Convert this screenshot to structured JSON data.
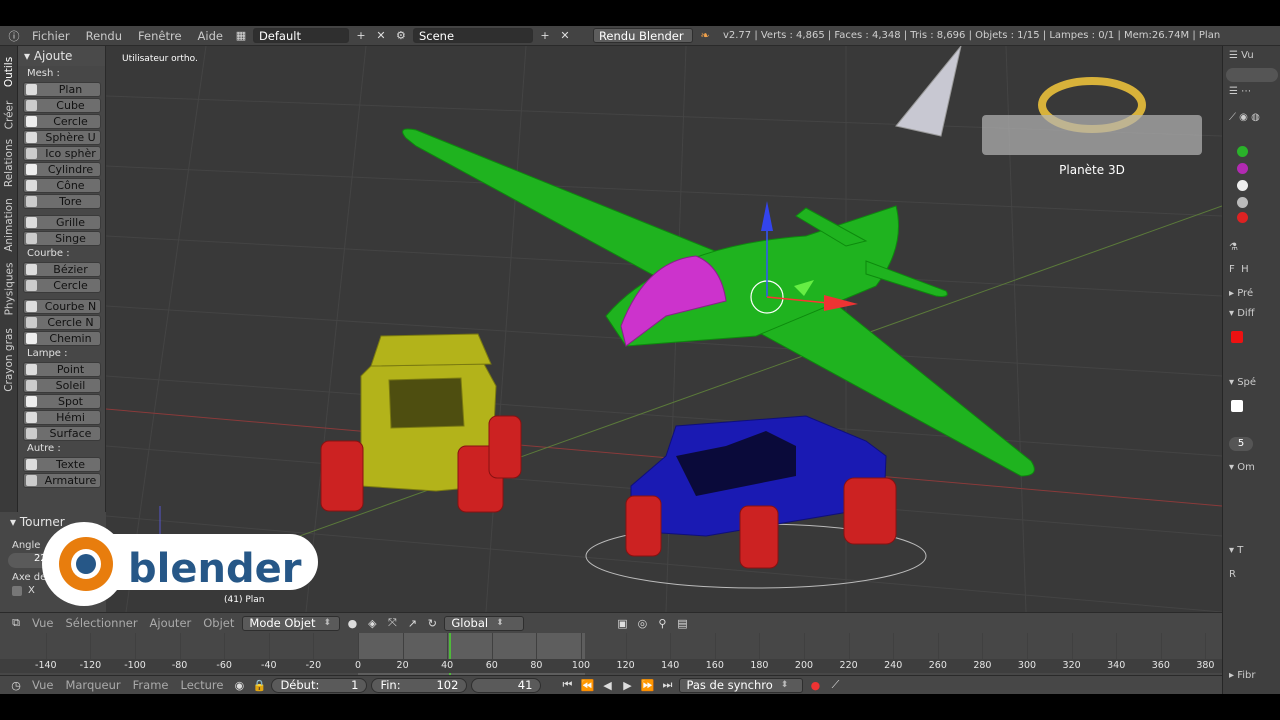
{
  "topbar": {
    "menus": [
      "Fichier",
      "Rendu",
      "Fenêtre",
      "Aide"
    ],
    "layout": "Default",
    "scene": "Scene",
    "engine": "Rendu Blender",
    "stats": "v2.77 | Verts : 4,865 | Faces : 4,348 | Tris : 8,696 | Objets : 1/15 | Lampes : 0/1 | Mem:26.74M | Plan"
  },
  "tabs": [
    "Outils",
    "Créer",
    "Relations",
    "Animation",
    "Physiques",
    "Crayon gras"
  ],
  "toolshelf": {
    "title": "Ajoute",
    "sections": [
      {
        "label": "Mesh :",
        "items": [
          "Plan",
          "Cube",
          "Cercle",
          "Sphère U",
          "Ico sphèr",
          "Cylindre",
          "Cône",
          "Tore"
        ]
      },
      {
        "label": "",
        "items": [
          "Grille",
          "Singe"
        ]
      },
      {
        "label": "Courbe :",
        "items": [
          "Bézier",
          "Cercle"
        ]
      },
      {
        "label": "",
        "items": [
          "Courbe N",
          "Cercle N",
          "Chemin"
        ]
      },
      {
        "label": "Lampe :",
        "items": [
          "Point",
          "Soleil",
          "Spot",
          "Hémi",
          "Surface"
        ]
      },
      {
        "label": "Autre :",
        "items": [
          "Texte",
          "Armature"
        ]
      }
    ]
  },
  "operator": {
    "title": "Tourner",
    "angle_label": "Angle",
    "angle_value": "22",
    "axis_label": "Axe de",
    "axis_x": "X"
  },
  "viewport": {
    "view_label": "Utilisateur ortho.",
    "object_label": "(41) Plan"
  },
  "view_header": {
    "menus": [
      "Vue",
      "Sélectionner",
      "Ajouter",
      "Objet"
    ],
    "mode": "Mode Objet",
    "orientation": "Global"
  },
  "timeline": {
    "ticks": [
      "-140",
      "-120",
      "-100",
      "-80",
      "-60",
      "-40",
      "-20",
      "0",
      "20",
      "40",
      "60",
      "80",
      "100",
      "120",
      "140",
      "160",
      "180",
      "200",
      "220",
      "240",
      "260",
      "280",
      "300",
      "320",
      "340",
      "360",
      "380"
    ],
    "range_start": 0,
    "range_end": 102,
    "current_frame": 41
  },
  "timeline_header": {
    "menus": [
      "Vue",
      "Marqueur",
      "Frame",
      "Lecture"
    ],
    "start_label": "Début:",
    "start_value": "1",
    "end_label": "Fin:",
    "end_value": "102",
    "current": "41",
    "sync": "Pas de synchro"
  },
  "properties": {
    "labels": [
      "Vu",
      "Pré",
      "Diff",
      "Spé",
      "Om",
      "T",
      "R",
      "Fibr"
    ],
    "value": "5",
    "f_label": "F",
    "h_label": "H"
  },
  "logo": {
    "text": "blender"
  },
  "brand": {
    "subtitle": "Planète 3D"
  },
  "colors": {
    "plane": "#1fb31f",
    "cockpit": "#cc33cc",
    "propeller": "#c8c8d2",
    "yellow_car": "#b3b31a",
    "blue_car": "#1a1ab3",
    "wheels": "#cc2222",
    "timeline_cursor": "#4fba3a"
  }
}
